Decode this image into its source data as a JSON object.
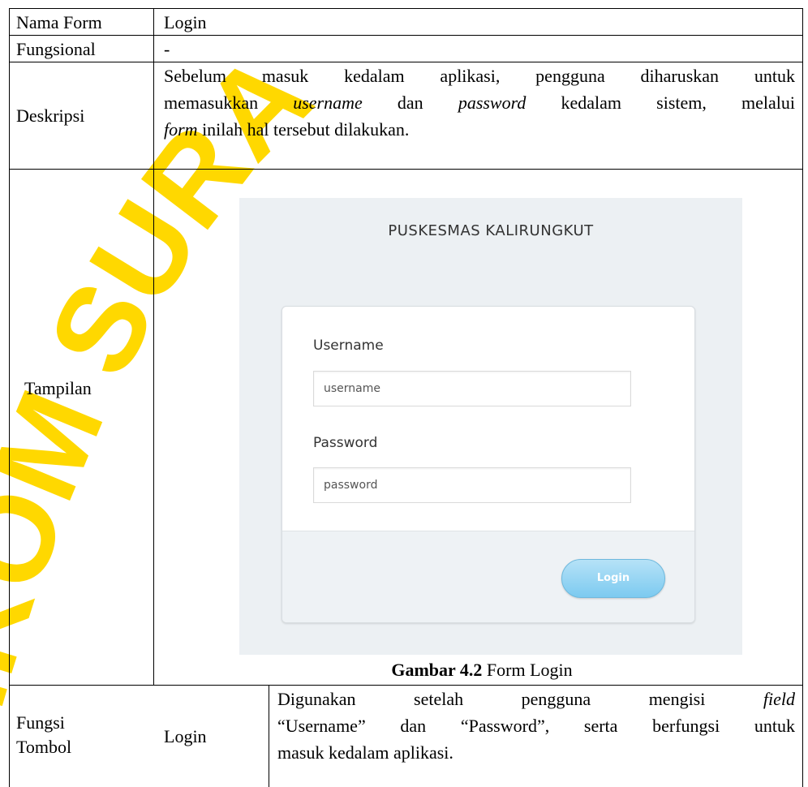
{
  "watermark": "IKOM SURA",
  "rows": {
    "nama_form": {
      "label": "Nama Form",
      "value": "Login"
    },
    "fungsional": {
      "label": "Fungsional",
      "value": "-"
    },
    "deskripsi": {
      "label": "Deskripsi",
      "line1": "Sebelum masuk kedalam aplikasi, pengguna diharuskan untuk",
      "line2_a": "memasukkan ",
      "line2_username": "username",
      "line2_b": " dan ",
      "line2_password": "password",
      "line2_c": " kedalam sistem, melalui",
      "line3_form": "form",
      "line3_rest": " inilah hal tersebut dilakukan."
    },
    "tampilan": {
      "label": "Tampilan"
    },
    "fungsi_tombol": {
      "label_line1": "Fungsi",
      "label_line2": "Tombol",
      "button": "Login",
      "desc_line1_a": "Digunakan setelah pengguna mengisi ",
      "desc_line1_field": "field",
      "desc_line2": "“Username” dan “Password”, serta berfungsi untuk",
      "desc_line3": "masuk kedalam aplikasi."
    }
  },
  "login_screen": {
    "title": "PUSKESMAS KALIRUNGKUT",
    "username_label": "Username",
    "username_placeholder": "username",
    "password_label": "Password",
    "password_placeholder": "password",
    "login_button": "Login"
  },
  "caption": {
    "bold": "Gambar 4.2",
    "text": " Form Login"
  }
}
